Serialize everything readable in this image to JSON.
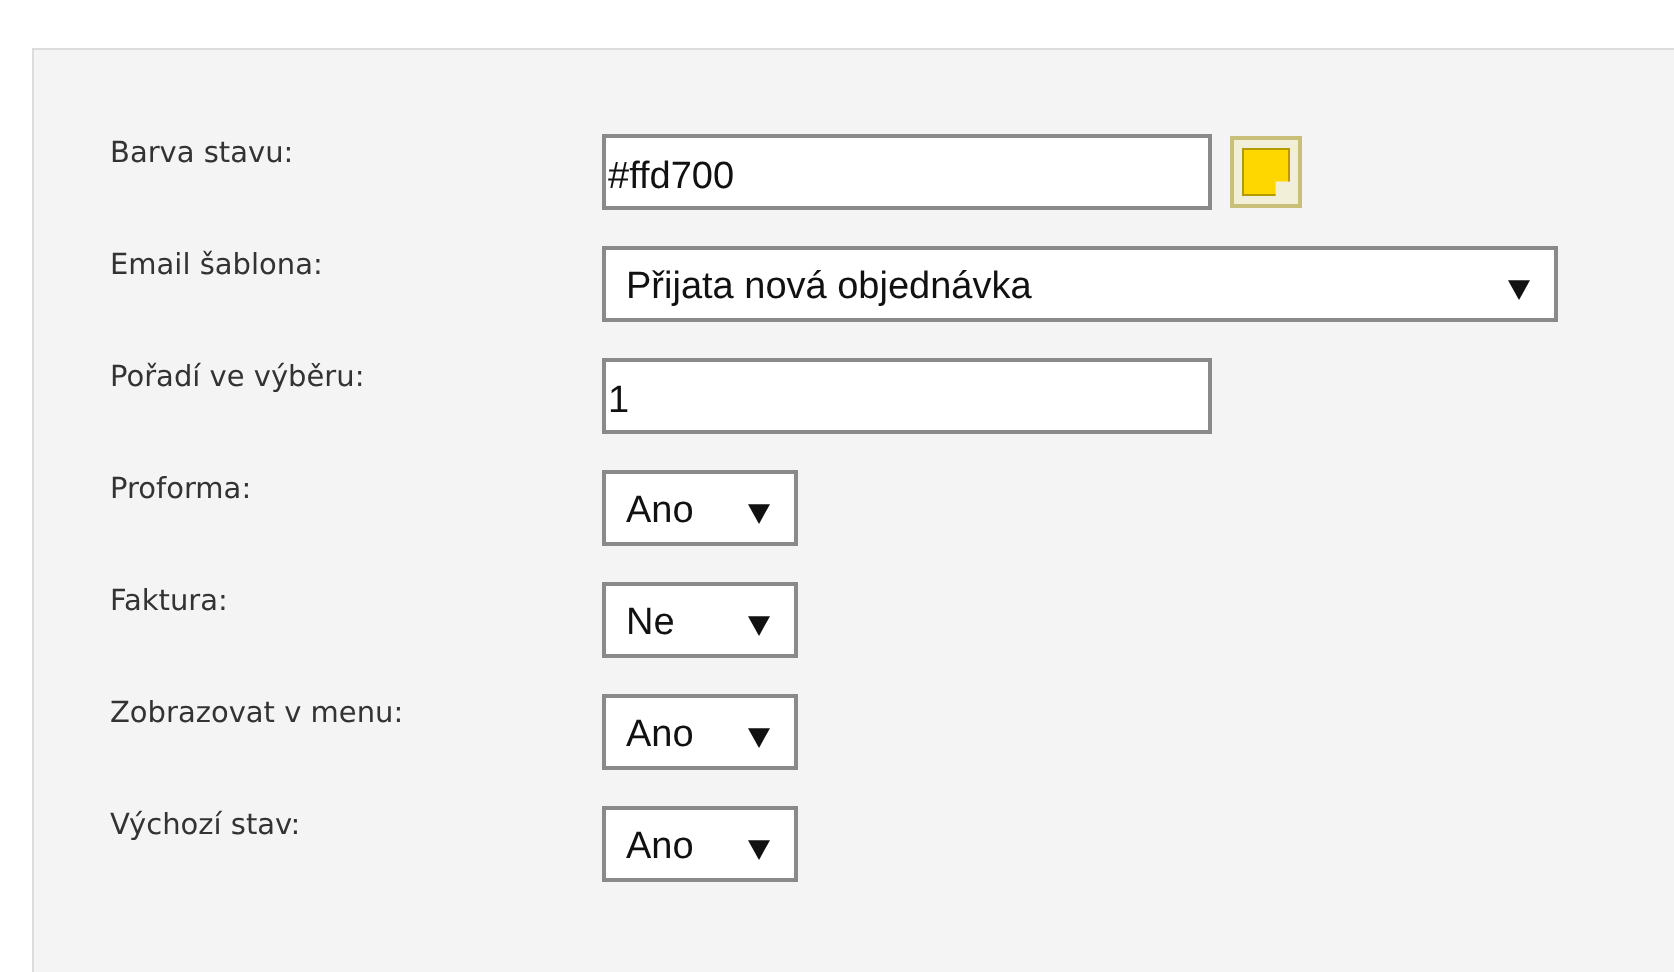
{
  "fields": [
    {
      "kind": "color",
      "label": "Barva stavu:",
      "value": "#ffd700",
      "color": "#ffd700"
    },
    {
      "kind": "select",
      "label": "Email šablona:",
      "value": "Přijata nová objednávka",
      "wide": true
    },
    {
      "kind": "text",
      "label": "Pořadí ve výběru:",
      "value": "1"
    },
    {
      "kind": "select",
      "label": "Proforma:",
      "value": "Ano",
      "wide": false
    },
    {
      "kind": "select",
      "label": "Faktura:",
      "value": "Ne",
      "wide": false
    },
    {
      "kind": "select",
      "label": "Zobrazovat v menu:",
      "value": "Ano",
      "wide": false
    },
    {
      "kind": "select",
      "label": "Výchozí stav:",
      "value": "Ano",
      "wide": false
    }
  ]
}
